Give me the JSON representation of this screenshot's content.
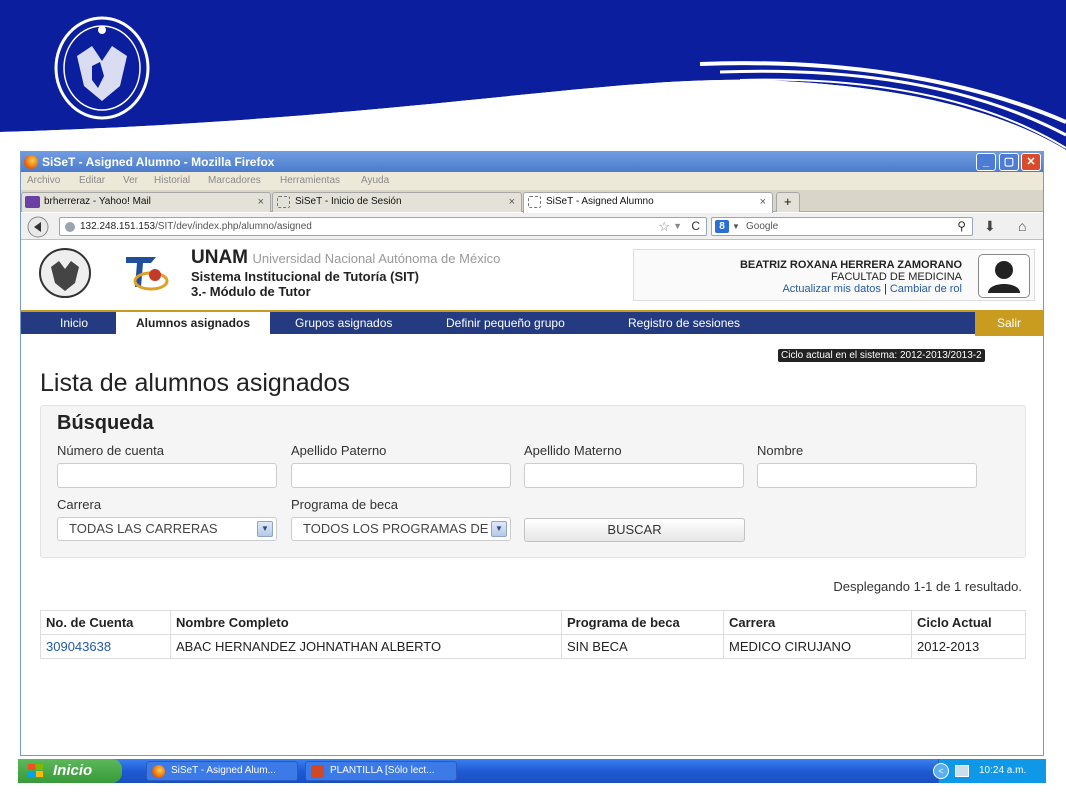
{
  "window": {
    "title": "SiSeT - Asigned Alumno - Mozilla Firefox",
    "controls": [
      "_",
      "▢",
      "✕"
    ]
  },
  "menu": [
    "Archivo",
    "Editar",
    "Ver",
    "Historial",
    "Marcadores",
    "Herramientas",
    "Ayuda"
  ],
  "tabs": [
    {
      "label": "brherreraz - Yahoo! Mail",
      "close": "×"
    },
    {
      "label": "SiSeT - Inicio de Sesión",
      "close": "×"
    },
    {
      "label": "SiSeT - Asigned Alumno",
      "close": "×"
    }
  ],
  "new_tab": "+",
  "address": {
    "url_host": "132.248.151.153",
    "url_path": "/SIT/dev/index.php/alumno/asigned"
  },
  "search": {
    "placeholder": "Google"
  },
  "site": {
    "unam": "UNAM",
    "unam_full": "Universidad Nacional Autónoma de México",
    "system": "Sistema Institucional de Tutoría (SIT)",
    "module": "3.- Módulo de Tutor",
    "user_name": "BEATRIZ ROXANA HERRERA ZAMORANO",
    "faculty": "FACULTAD DE MEDICINA",
    "update_link": "Actualizar mis datos",
    "separator": "|",
    "role_link": "Cambiar de rol"
  },
  "nav": {
    "items": [
      "Inicio",
      "Alumnos asignados",
      "Grupos asignados",
      "Definir pequeño grupo",
      "Registro de sesiones"
    ],
    "logout": "Salir"
  },
  "cycle_badge": "Ciclo actual en el sistema: 2012-2013/2013-2",
  "page_title": "Lista de alumnos asignados",
  "search_panel": {
    "heading": "Búsqueda",
    "fields": {
      "cuenta": "Número de cuenta",
      "paterno": "Apellido Paterno",
      "materno": "Apellido Materno",
      "nombre": "Nombre",
      "carrera": "Carrera",
      "beca": "Programa de beca"
    },
    "carrera_value": "TODAS LAS CARRERAS",
    "beca_value": "TODOS LOS PROGRAMAS DE",
    "button": "BUSCAR"
  },
  "results_summary": "Desplegando 1-1 de 1 resultado.",
  "table": {
    "headers": [
      "No. de Cuenta",
      "Nombre Completo",
      "Programa de beca",
      "Carrera",
      "Ciclo Actual"
    ],
    "rows": [
      [
        "309043638",
        "ABAC HERNANDEZ JOHNATHAN ALBERTO",
        "SIN BECA",
        "MEDICO CIRUJANO",
        "2012-2013"
      ]
    ]
  },
  "taskbar": {
    "start": "Inicio",
    "buttons": [
      "SiSeT - Asigned Alum...",
      "PLANTILLA [Sólo lect..."
    ],
    "clock": "10:24 a.m."
  },
  "colors": {
    "slide_blue": "#0a1e9e",
    "nav_blue": "#243b82",
    "gold": "#c99b1e",
    "link": "#245aa5"
  }
}
